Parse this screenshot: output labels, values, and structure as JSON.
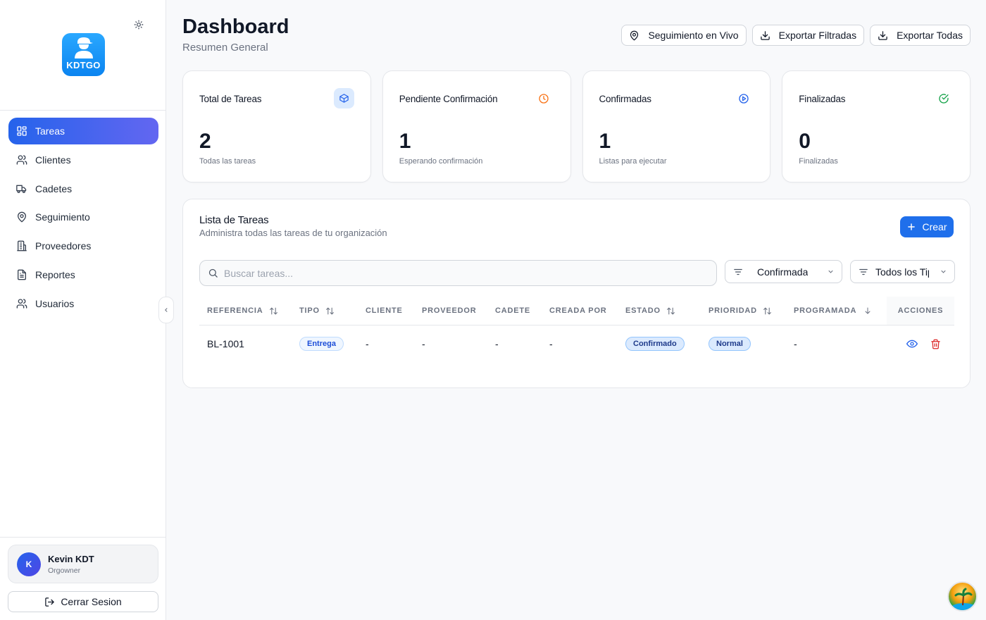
{
  "sidebar": {
    "logo_text": "KDTGO",
    "nav": [
      {
        "label": "Tareas",
        "icon": "grid-icon",
        "active": true
      },
      {
        "label": "Clientes",
        "icon": "users-icon"
      },
      {
        "label": "Cadetes",
        "icon": "truck-icon"
      },
      {
        "label": "Seguimiento",
        "icon": "map-pin-icon"
      },
      {
        "label": "Proveedores",
        "icon": "building-icon"
      },
      {
        "label": "Reportes",
        "icon": "file-text-icon"
      },
      {
        "label": "Usuarios",
        "icon": "users-icon"
      }
    ],
    "user": {
      "initial": "K",
      "name": "Kevin KDT",
      "role": "Orgowner"
    },
    "logout_label": "Cerrar Sesion"
  },
  "header": {
    "title": "Dashboard",
    "subtitle": "Resumen General",
    "actions": [
      {
        "label": "Seguimiento en Vivo",
        "icon": "map-pin-icon"
      },
      {
        "label": "Exportar Filtradas",
        "icon": "download-icon"
      },
      {
        "label": "Exportar Todas",
        "icon": "download-icon"
      }
    ]
  },
  "stats": [
    {
      "label": "Total de Tareas",
      "value": "2",
      "desc": "Todas las tareas",
      "icon": "package-icon",
      "color": "#2563eb"
    },
    {
      "label": "Pendiente Confirmación",
      "value": "1",
      "desc": "Esperando confirmación",
      "icon": "clock-icon",
      "color": "#f97316"
    },
    {
      "label": "Confirmadas",
      "value": "1",
      "desc": "Listas para ejecutar",
      "icon": "play-circle-icon",
      "color": "#2563eb"
    },
    {
      "label": "Finalizadas",
      "value": "0",
      "desc": "Finalizadas",
      "icon": "check-circle-icon",
      "color": "#16a34a"
    }
  ],
  "tasks": {
    "title": "Lista de Tareas",
    "subtitle": "Administra todas las tareas de tu organización",
    "create_label": "Crear",
    "search_placeholder": "Buscar tareas...",
    "filters": {
      "status": "Confirmada",
      "type": "Todos los Tipos"
    },
    "columns": [
      "REFERENCIA",
      "TIPO",
      "CLIENTE",
      "PROVEEDOR",
      "CADETE",
      "CREADA POR",
      "ESTADO",
      "PRIORIDAD",
      "PROGRAMADA",
      "ACCIONES"
    ],
    "rows": [
      {
        "referencia": "BL-1001",
        "tipo": "Entrega",
        "cliente": "-",
        "proveedor": "-",
        "cadete": "-",
        "creada_por": "-",
        "estado": "Confirmado",
        "prioridad": "Normal",
        "programada": "-"
      }
    ]
  }
}
